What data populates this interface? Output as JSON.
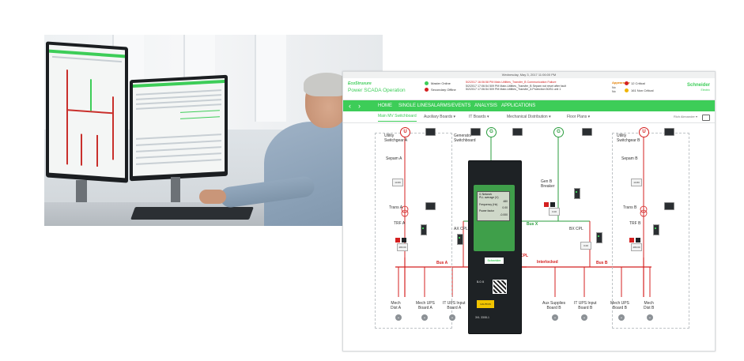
{
  "scada": {
    "date_time": "Wednesday, May 3, 2017 11:06:00 PM",
    "brand_italic": "EcoStruxure",
    "app_title": "Power SCADA Operation",
    "servers": [
      {
        "label": "Master Online",
        "color": "#3dcd58"
      },
      {
        "label": "Secondary Offline",
        "color": "#d42020"
      }
    ],
    "alarms": [
      {
        "time": "5/2/2017 16:06:58 PM",
        "text": "Main-Utilities_Transfer_B Communication Failure",
        "ack": "No"
      },
      {
        "time": "5/2/2017 17:06:54 509 PM",
        "text": "Main-Utilities_Transfer_B Sepam not reset after fault",
        "ack": "No"
      },
      {
        "time": "5/2/2017 17:06:54 509 PM",
        "text": "Main-Utilities_Transfer_A Protection 50/51 unit 1",
        "ack": "No"
      }
    ],
    "appearance_label": "Appearance",
    "counts": [
      {
        "label": "12 Critical",
        "color": "#d42020"
      },
      {
        "label": "161 Non Critical",
        "color": "#f0b400"
      }
    ],
    "logo": {
      "name": "Schneider",
      "sub": "Electric"
    },
    "nav": {
      "back_icon": "chevron-left-icon",
      "forward_icon": "chevron-right-icon",
      "items": [
        "HOME",
        "SINGLE LINES",
        "ALARMS/EVENTS",
        "ANALYSIS",
        "APPLICATIONS"
      ]
    },
    "subnav": {
      "items": [
        "Main MV Switchboard",
        "Auxiliary Boards ▾",
        "IT Boards ▾",
        "Mechanical Distribution ▾",
        "Floor Plans ▾"
      ],
      "user": "Rich Alexander ▾"
    },
    "diagram": {
      "utility_a": "Utility\nSwitchgear A",
      "utility_b": "Utility\nSwitchgear B",
      "generator": "Generator\nSwitchboard",
      "sepam_a": "Sepam A",
      "sepam_b": "Sepam B",
      "trans_a": "Trans A",
      "trans_b": "Trans B",
      "trf_a": "TRF A",
      "trf_b": "TRF B",
      "ax_cpl": "AX CPL",
      "bx_cpl": "BX CPL",
      "gen_b_breaker": "Gen B\nBreaker",
      "bus_a": "Bus A",
      "bus_b": "Bus B",
      "bus_x": "Bus X",
      "cpl": "CPL",
      "interlocked": "Interlocked",
      "feeders": [
        "Mech\nDist A",
        "Mech UPS\nBoard A",
        "IT UPS Input\nBoard A",
        "Aux Supplies\nBoard B",
        "IT UPS Input\nBoard B",
        "Mech UPS\nBoard B",
        "Mech\nDist B"
      ],
      "values": {
        "ua_kv": "13.80",
        "trf_a_v": "480.00",
        "trf_b_v": "480.00",
        "gen_kv": "0.00",
        "ub_kv": "13.80"
      },
      "gen_symbol": "G",
      "util_symbol": "U"
    },
    "device": {
      "screen": [
        "I1 Network",
        "PLL average (V)",
        "480",
        "Frequency (Hz)",
        "0.00",
        "Power factor",
        "-0.000"
      ],
      "brand": "Schneider",
      "rating": "5.0 X",
      "caution": "CAUTION",
      "model": "3VL 3308-1"
    }
  }
}
